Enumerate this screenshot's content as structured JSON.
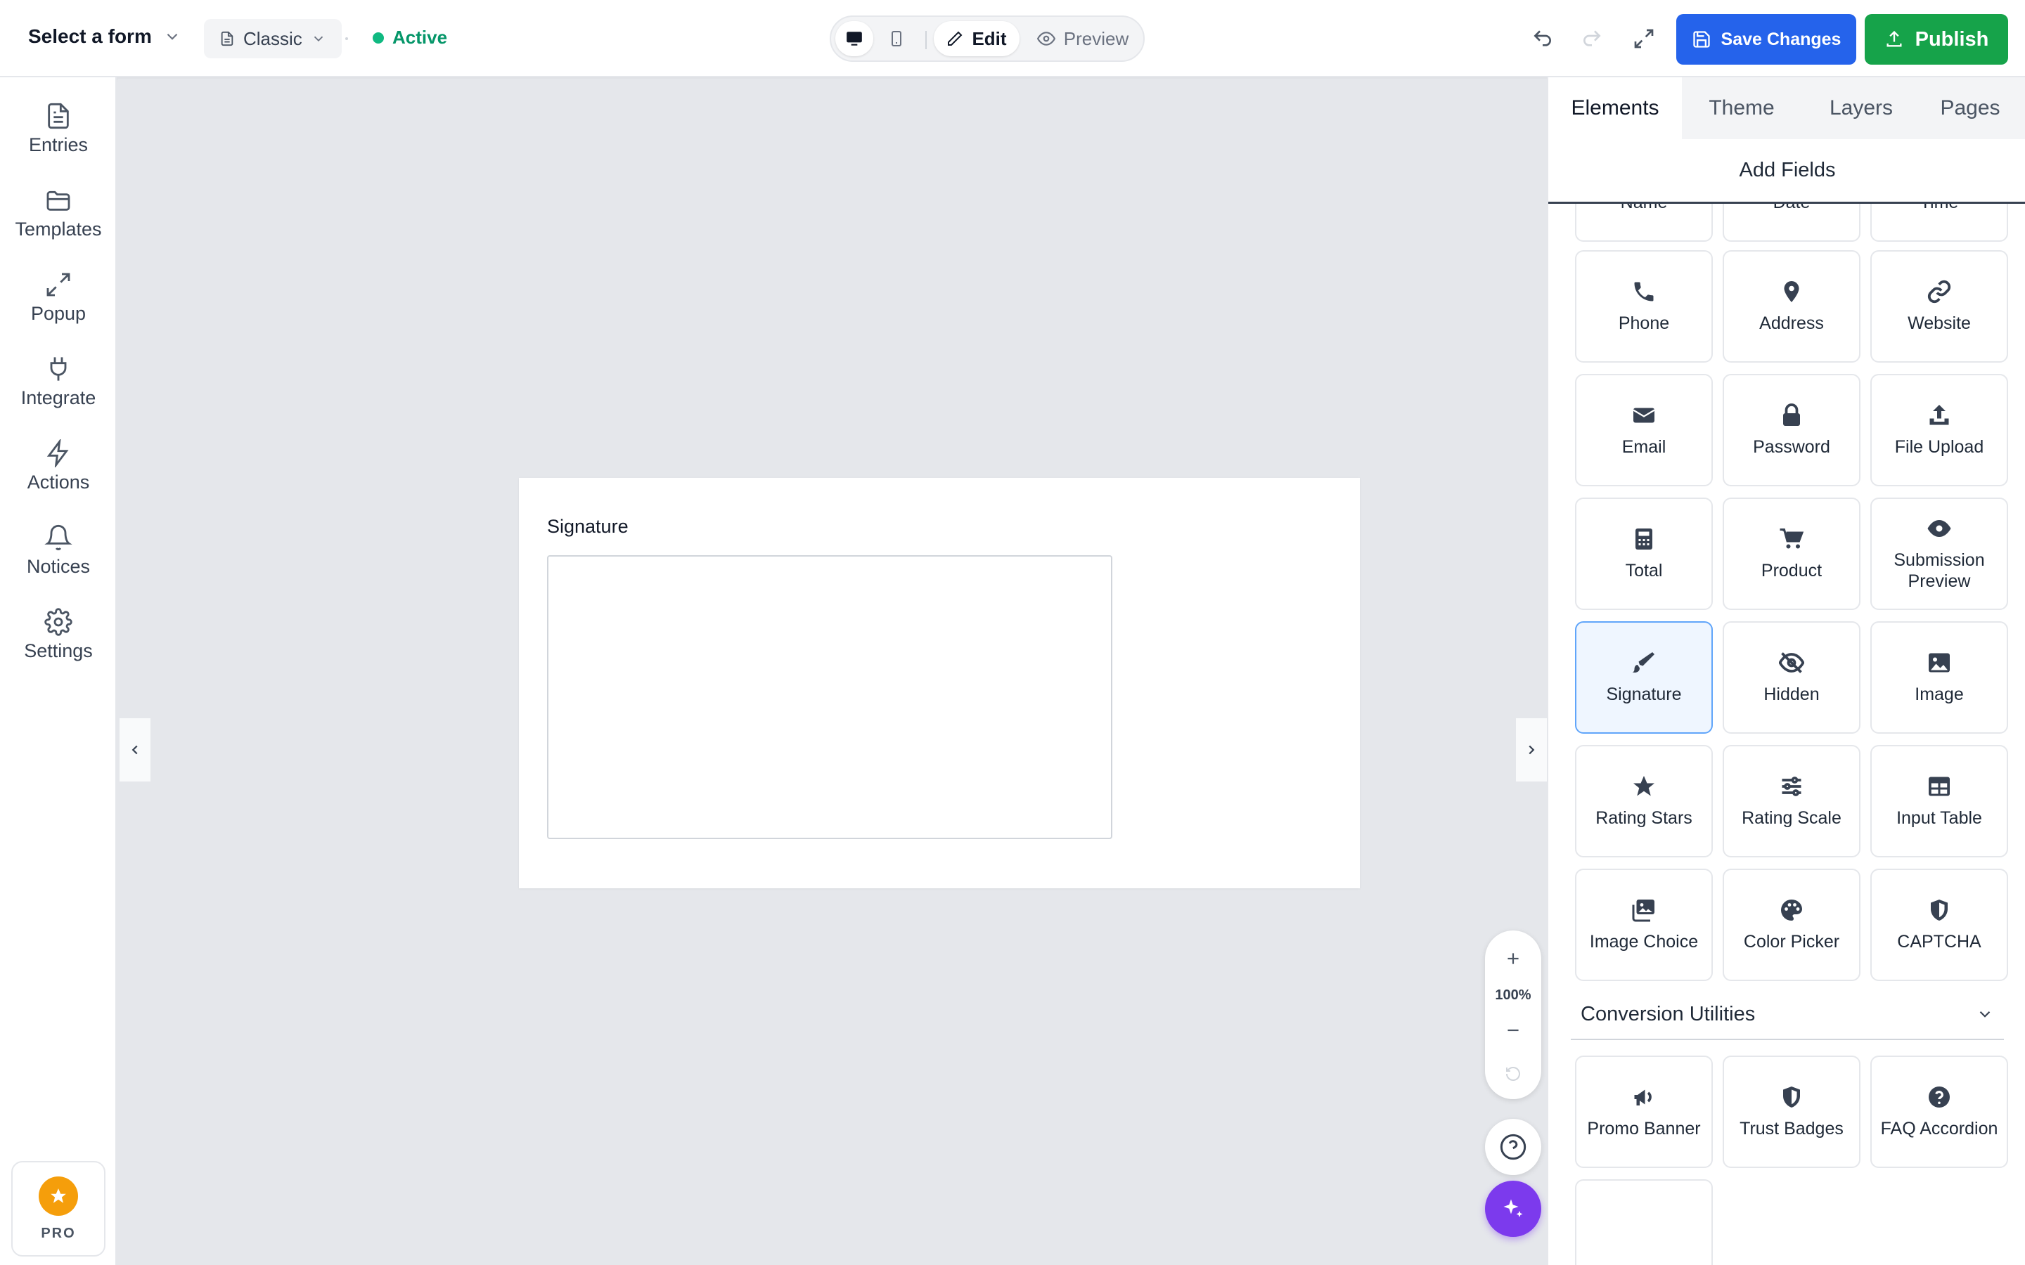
{
  "header": {
    "form_select": "Select a form",
    "layout": "Classic",
    "status": "Active",
    "edit": "Edit",
    "preview": "Preview",
    "save": "Save Changes",
    "publish": "Publish"
  },
  "sidebar": {
    "items": [
      {
        "label": "Entries",
        "icon": "file-icon"
      },
      {
        "label": "Templates",
        "icon": "folder-icon"
      },
      {
        "label": "Popup",
        "icon": "expand-icon"
      },
      {
        "label": "Integrate",
        "icon": "plug-icon"
      },
      {
        "label": "Actions",
        "icon": "lightning-icon"
      },
      {
        "label": "Notices",
        "icon": "bell-icon"
      },
      {
        "label": "Settings",
        "icon": "gear-icon"
      }
    ],
    "pro": "PRO"
  },
  "canvas": {
    "field_label": "Signature",
    "zoom": "100%"
  },
  "panel": {
    "tabs": [
      "Elements",
      "Theme",
      "Layers",
      "Pages"
    ],
    "active_tab": "Elements",
    "section": "Add Fields",
    "fields": [
      {
        "label": "Name",
        "icon": "user-icon"
      },
      {
        "label": "Date",
        "icon": "calendar-icon"
      },
      {
        "label": "Time",
        "icon": "clock-icon"
      },
      {
        "label": "Phone",
        "icon": "phone-icon"
      },
      {
        "label": "Address",
        "icon": "map-pin-icon"
      },
      {
        "label": "Website",
        "icon": "link-icon"
      },
      {
        "label": "Email",
        "icon": "envelope-icon"
      },
      {
        "label": "Password",
        "icon": "lock-icon"
      },
      {
        "label": "File Upload",
        "icon": "upload-icon"
      },
      {
        "label": "Total",
        "icon": "calculator-icon"
      },
      {
        "label": "Product",
        "icon": "cart-icon"
      },
      {
        "label": "Submission Preview",
        "icon": "eye-icon"
      },
      {
        "label": "Signature",
        "icon": "pen-icon"
      },
      {
        "label": "Hidden",
        "icon": "eye-slash-icon"
      },
      {
        "label": "Image",
        "icon": "image-icon"
      },
      {
        "label": "Rating Stars",
        "icon": "star-icon"
      },
      {
        "label": "Rating Scale",
        "icon": "sliders-icon"
      },
      {
        "label": "Input Table",
        "icon": "table-icon"
      },
      {
        "label": "Image Choice",
        "icon": "images-icon"
      },
      {
        "label": "Color Picker",
        "icon": "palette-icon"
      },
      {
        "label": "CAPTCHA",
        "icon": "shield-icon"
      }
    ],
    "group": "Conversion Utilities",
    "group_fields": [
      {
        "label": "Promo Banner",
        "icon": "megaphone-icon"
      },
      {
        "label": "Trust Badges",
        "icon": "shield-check-icon"
      },
      {
        "label": "FAQ Accordion",
        "icon": "question-icon"
      }
    ]
  },
  "colors": {
    "primary": "#2563eb",
    "publish": "#16a34a",
    "active": "#059669",
    "ai": "#7c3aed",
    "pro": "#f59e0b"
  }
}
